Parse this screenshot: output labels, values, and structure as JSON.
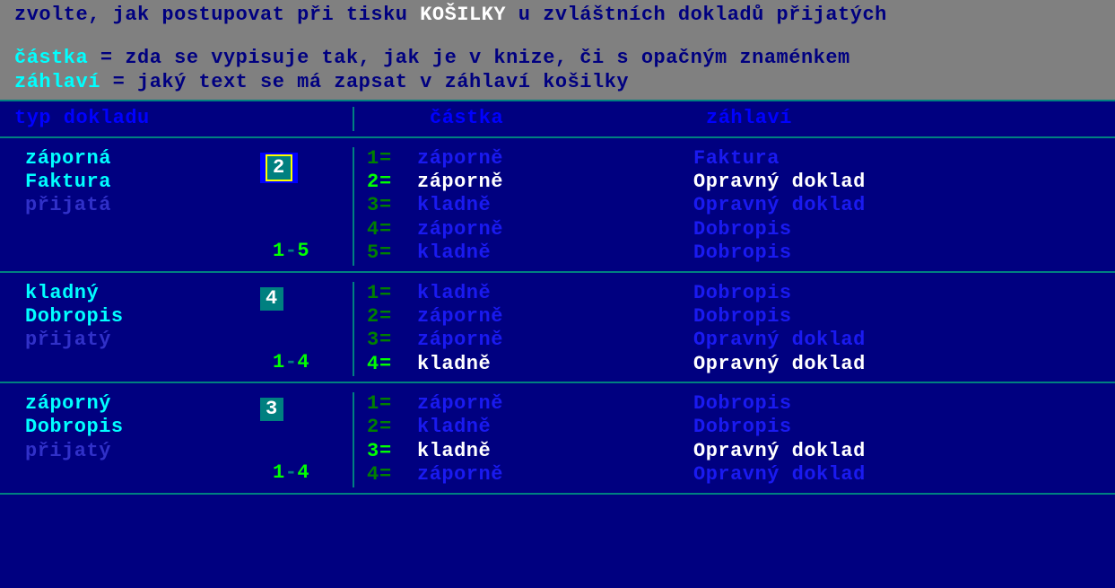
{
  "header": {
    "line1_pre": "zvolte, jak postupovat při tisku ",
    "line1_h": "KOŠILKY",
    "line1_post": " u zvláštních dokladů přijatých",
    "l2_label": "částka",
    "l2_text": " = zda se vypisuje tak, jak je v knize, či s opačným znaménkem",
    "l3_label": "záhlaví",
    "l3_text": " = jaký text se má zapsat v záhlaví košilky"
  },
  "columns": {
    "c1": "typ dokladu",
    "c2": "částka",
    "c3": "záhlaví"
  },
  "rows": [
    {
      "doc": {
        "l1": "záporná",
        "l2": "Faktura",
        "l3": "přijatá"
      },
      "value": "2",
      "active": true,
      "range": {
        "from": "1",
        "to": "5"
      },
      "options": [
        {
          "n": "1",
          "amt": "záporně",
          "hdr": "Faktura",
          "sel": false
        },
        {
          "n": "2",
          "amt": "záporně",
          "hdr": "Opravný doklad",
          "sel": true
        },
        {
          "n": "3",
          "amt": "kladně",
          "hdr": "Opravný doklad",
          "sel": false
        },
        {
          "n": "4",
          "amt": "záporně",
          "hdr": "Dobropis",
          "sel": false
        },
        {
          "n": "5",
          "amt": "kladně",
          "hdr": "Dobropis",
          "sel": false
        }
      ]
    },
    {
      "doc": {
        "l1": "kladný",
        "l2": "Dobropis",
        "l3": "přijatý"
      },
      "value": "4",
      "active": false,
      "range": {
        "from": "1",
        "to": "4"
      },
      "options": [
        {
          "n": "1",
          "amt": "kladně",
          "hdr": "Dobropis",
          "sel": false
        },
        {
          "n": "2",
          "amt": "záporně",
          "hdr": "Dobropis",
          "sel": false
        },
        {
          "n": "3",
          "amt": "záporně",
          "hdr": "Opravný doklad",
          "sel": false
        },
        {
          "n": "4",
          "amt": "kladně",
          "hdr": "Opravný doklad",
          "sel": true
        }
      ]
    },
    {
      "doc": {
        "l1": "záporný",
        "l2": "Dobropis",
        "l3": "přijatý"
      },
      "value": "3",
      "active": false,
      "range": {
        "from": "1",
        "to": "4"
      },
      "options": [
        {
          "n": "1",
          "amt": "záporně",
          "hdr": "Dobropis",
          "sel": false
        },
        {
          "n": "2",
          "amt": "kladně",
          "hdr": "Dobropis",
          "sel": false
        },
        {
          "n": "3",
          "amt": "kladně",
          "hdr": "Opravný doklad",
          "sel": true
        },
        {
          "n": "4",
          "amt": "záporně",
          "hdr": "Opravný doklad",
          "sel": false
        }
      ]
    }
  ]
}
